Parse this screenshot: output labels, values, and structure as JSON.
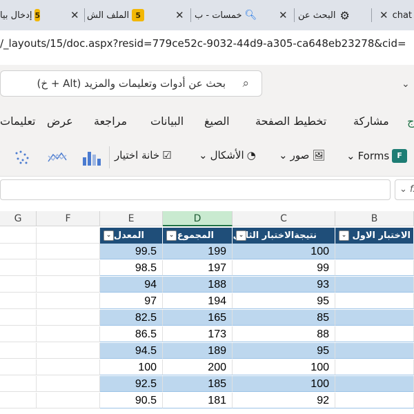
{
  "browser": {
    "tabs": [
      {
        "label": "chat",
        "icon": "close-icon"
      },
      {
        "label": "إدخال بيا",
        "badge": "5"
      },
      {
        "label": "الملف الش",
        "badge": "5"
      },
      {
        "label": "خمسات - ب",
        "icon": "search-icon"
      },
      {
        "label": "البحث عن",
        "icon": "openai-icon"
      }
    ],
    "url": "/_layouts/15/doc.aspx?resid=779ce52c-9032-44d9-a305-ca648eb23278&cid="
  },
  "search": {
    "placeholder": "بحث عن أدوات وتعليمات والمزيد (Alt + خ)"
  },
  "menu": {
    "items": [
      "تعليمات",
      "عرض",
      "مراجعة",
      "البيانات",
      "الصيغ",
      "تخطيط الصفحة",
      "مشاركة",
      "ج"
    ]
  },
  "ribbon": {
    "checkbox_label": "خانة اختيار",
    "shapes_label": "الأشكال",
    "pictures_label": "صور",
    "forms_label": "Forms"
  },
  "formula": {
    "fx": "fx"
  },
  "sheet": {
    "columns": [
      "G",
      "F",
      "E",
      "D",
      "C",
      "B"
    ],
    "selected_column": "D",
    "headers": {
      "E": "المعدل",
      "D": "المجموع",
      "C": "نتيجةالاختبار الثاني",
      "B": "الاختبار الاول"
    },
    "rows": [
      {
        "E": "99.5",
        "D": "199",
        "C": "100"
      },
      {
        "E": "98.5",
        "D": "197",
        "C": "99"
      },
      {
        "E": "94",
        "D": "188",
        "C": "93"
      },
      {
        "E": "97",
        "D": "194",
        "C": "95"
      },
      {
        "E": "82.5",
        "D": "165",
        "C": "85"
      },
      {
        "E": "86.5",
        "D": "173",
        "C": "88"
      },
      {
        "E": "94.5",
        "D": "189",
        "C": "95"
      },
      {
        "E": "100",
        "D": "200",
        "C": "100"
      },
      {
        "E": "92.5",
        "D": "185",
        "C": "100"
      },
      {
        "E": "90.5",
        "D": "181",
        "C": "92"
      }
    ]
  }
}
